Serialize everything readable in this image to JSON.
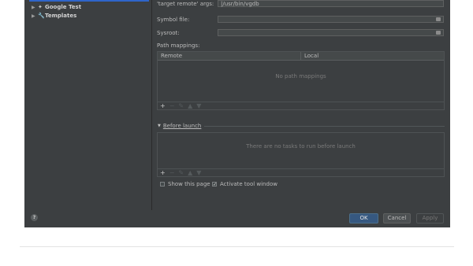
{
  "sidebar": {
    "items": [
      {
        "label": "Google Test",
        "icon": "googletest-icon"
      },
      {
        "label": "Templates",
        "icon": "wrench-icon"
      }
    ]
  },
  "form": {
    "target_remote_args": {
      "label": "'target remote' args:",
      "value": "|/usr/bin/vgdb"
    },
    "symbol_file": {
      "label": "Symbol file:",
      "value": ""
    },
    "sysroot": {
      "label": "Sysroot:",
      "value": ""
    },
    "path_mappings_label": "Path mappings:"
  },
  "mappings_table": {
    "columns": [
      "Remote",
      "Local"
    ],
    "empty_text": "No path mappings",
    "toolbar": [
      "+",
      "−",
      "✎",
      "▲",
      "▼"
    ]
  },
  "before_launch": {
    "title": "Before launch",
    "empty_text": "There are no tasks to run before launch",
    "toolbar": [
      "+",
      "−",
      "✎",
      "▲",
      "▼"
    ]
  },
  "options": {
    "show_this_page": {
      "label": "Show this page",
      "checked": false
    },
    "activate_tool_window": {
      "label": "Activate tool window",
      "checked": true
    }
  },
  "footer": {
    "help": "?",
    "ok": "OK",
    "cancel": "Cancel",
    "apply": "Apply"
  },
  "colors": {
    "dialog_bg": "#3c3f41",
    "selection": "#2f65ca",
    "ok_button": "#365880"
  }
}
